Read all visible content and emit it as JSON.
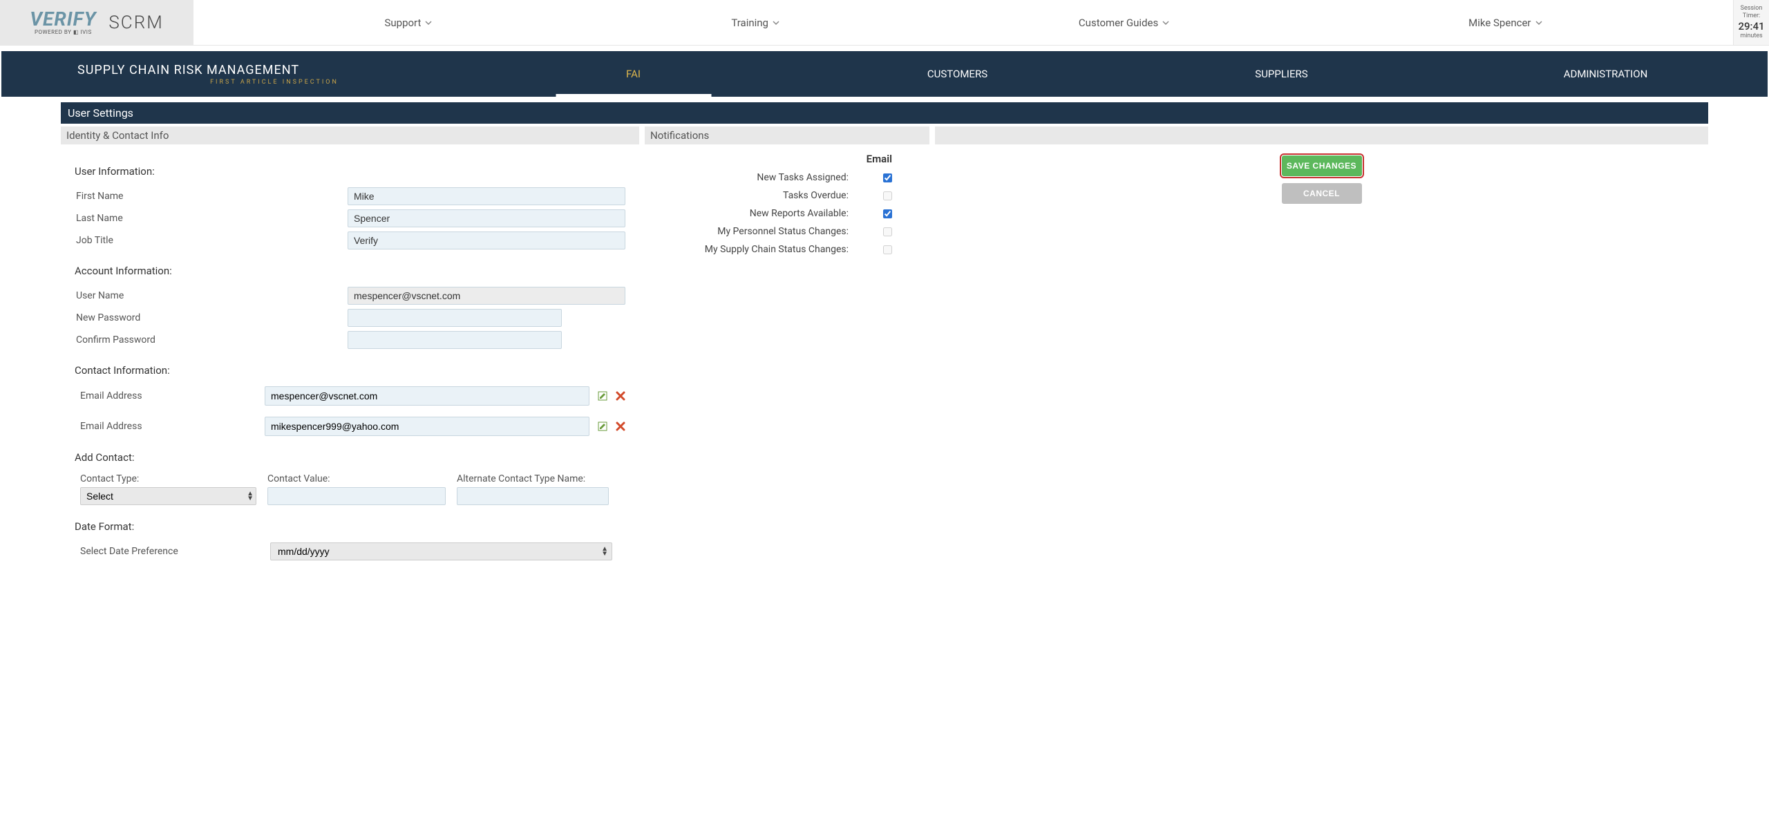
{
  "header": {
    "logo_main": "VERIFY",
    "logo_sub": "POWERED BY ◧ IVIS",
    "logo_right": "SCRM",
    "nav": {
      "support": "Support",
      "training": "Training",
      "guides": "Customer Guides",
      "user": "Mike Spencer"
    },
    "session": {
      "label1": "Session",
      "label2": "Timer:",
      "time": "29:41",
      "unit": "minutes"
    }
  },
  "darknav": {
    "title": "SUPPLY CHAIN RISK MANAGEMENT",
    "subtitle": "FIRST ARTICLE INSPECTION",
    "tabs": {
      "fai": "FAI",
      "customers": "CUSTOMERS",
      "suppliers": "SUPPLIERS",
      "admin": "ADMINISTRATION"
    }
  },
  "page": {
    "title": "User Settings",
    "identity_header": "Identity & Contact Info",
    "notifications_header": "Notifications"
  },
  "identity": {
    "user_info_title": "User Information:",
    "first_name_label": "First Name",
    "first_name_value": "Mike",
    "last_name_label": "Last Name",
    "last_name_value": "Spencer",
    "job_title_label": "Job Title",
    "job_title_value": "Verify",
    "account_info_title": "Account Information:",
    "user_name_label": "User Name",
    "user_name_value": "mespencer@vscnet.com",
    "new_password_label": "New Password",
    "confirm_password_label": "Confirm Password",
    "contact_info_title": "Contact Information:",
    "email_label": "Email Address",
    "email1_value": "mespencer@vscnet.com",
    "email2_value": "mikespencer999@yahoo.com",
    "add_contact_title": "Add Contact:",
    "contact_type_label": "Contact Type:",
    "contact_type_selected": "Select",
    "contact_value_label": "Contact Value:",
    "alt_type_label": "Alternate Contact Type Name:",
    "date_format_title": "Date Format:",
    "date_pref_label": "Select Date Preference",
    "date_pref_value": "mm/dd/yyyy"
  },
  "notifications": {
    "column_header": "Email",
    "rows": [
      {
        "label": "New Tasks Assigned:",
        "checked": true,
        "disabled": false
      },
      {
        "label": "Tasks Overdue:",
        "checked": false,
        "disabled": true
      },
      {
        "label": "New Reports Available:",
        "checked": true,
        "disabled": false
      },
      {
        "label": "My Personnel Status Changes:",
        "checked": false,
        "disabled": true
      },
      {
        "label": "My Supply Chain Status Changes:",
        "checked": false,
        "disabled": true
      }
    ]
  },
  "actions": {
    "save": "SAVE CHANGES",
    "cancel": "CANCEL"
  }
}
